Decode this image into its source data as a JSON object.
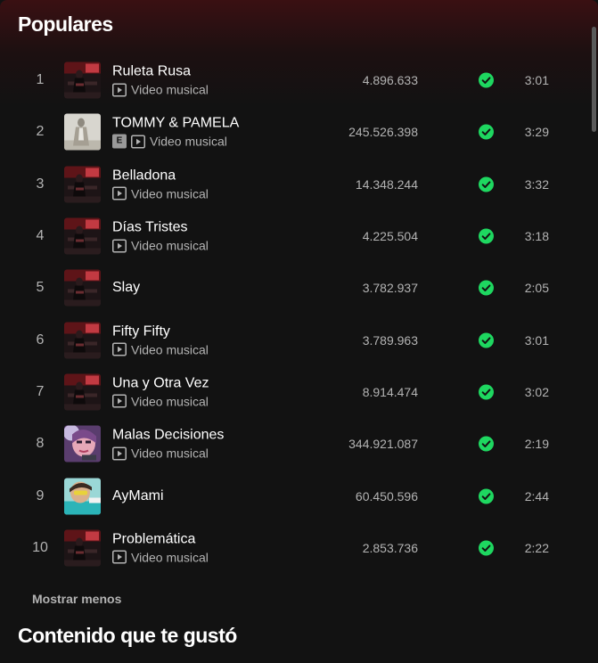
{
  "popular": {
    "title": "Populares",
    "tracks": [
      {
        "number": "1",
        "title": "Ruleta Rusa",
        "explicit": false,
        "video_label": "Video musical",
        "plays": "4.896.633",
        "duration": "3:01",
        "cover": "red-stage"
      },
      {
        "number": "2",
        "title": "TOMMY & PAMELA",
        "explicit": true,
        "explicit_label": "E",
        "video_label": "Video musical",
        "plays": "245.526.398",
        "duration": "3:29",
        "cover": "pale-figure"
      },
      {
        "number": "3",
        "title": "Belladona",
        "explicit": false,
        "video_label": "Video musical",
        "plays": "14.348.244",
        "duration": "3:32",
        "cover": "red-stage"
      },
      {
        "number": "4",
        "title": "Días Tristes",
        "explicit": false,
        "video_label": "Video musical",
        "plays": "4.225.504",
        "duration": "3:18",
        "cover": "red-stage"
      },
      {
        "number": "5",
        "title": "Slay",
        "explicit": false,
        "plays": "3.782.937",
        "duration": "2:05",
        "cover": "red-stage"
      },
      {
        "number": "6",
        "title": "Fifty Fifty",
        "explicit": false,
        "video_label": "Video musical",
        "plays": "3.789.963",
        "duration": "3:01",
        "cover": "red-stage"
      },
      {
        "number": "7",
        "title": "Una y Otra Vez",
        "explicit": false,
        "video_label": "Video musical",
        "plays": "8.914.474",
        "duration": "3:02",
        "cover": "red-stage"
      },
      {
        "number": "8",
        "title": "Malas Decisiones",
        "explicit": false,
        "video_label": "Video musical",
        "plays": "344.921.087",
        "duration": "2:19",
        "cover": "pink-face"
      },
      {
        "number": "9",
        "title": "AyMami",
        "explicit": false,
        "plays": "60.450.596",
        "duration": "2:44",
        "cover": "teal-beach"
      },
      {
        "number": "10",
        "title": "Problemática",
        "explicit": false,
        "video_label": "Video musical",
        "plays": "2.853.736",
        "duration": "2:22",
        "cover": "red-stage"
      }
    ],
    "show_less_label": "Mostrar menos"
  },
  "liked_section": {
    "title": "Contenido que te gustó"
  },
  "icons": {
    "saved": "check-circle-icon",
    "video": "play-square-icon"
  },
  "colors": {
    "accent_green": "#1ed760",
    "background": "#121212",
    "header_tint": "#3a1012",
    "secondary_text": "#b3b3b3"
  }
}
